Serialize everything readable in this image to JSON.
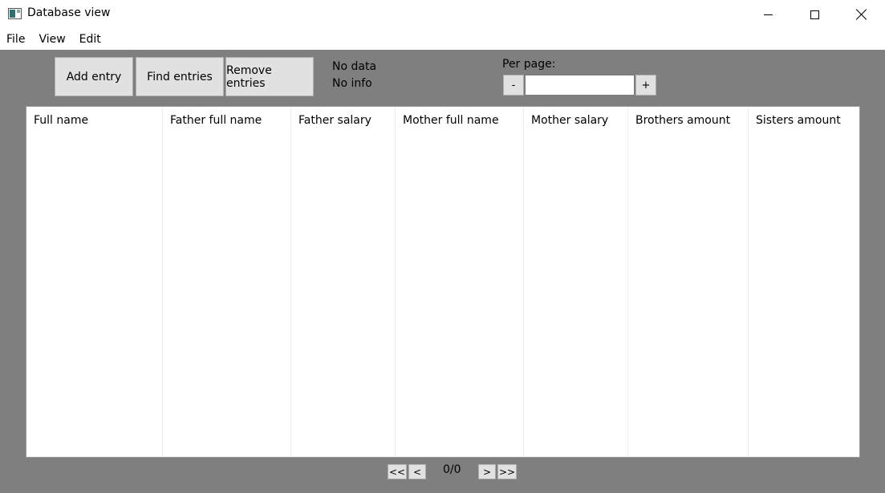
{
  "window": {
    "title": "Database view"
  },
  "menu": {
    "items": [
      {
        "label": "File"
      },
      {
        "label": "View"
      },
      {
        "label": "Edit"
      }
    ]
  },
  "toolbar": {
    "add_label": "Add entry",
    "find_label": "Find entries",
    "remove_label": "Remove entries"
  },
  "status": {
    "data_text": "No data",
    "info_text": "No info"
  },
  "per_page": {
    "label": "Per page:",
    "minus_label": "-",
    "plus_label": "+",
    "value": ""
  },
  "table": {
    "columns": [
      {
        "label": "Full name"
      },
      {
        "label": "Father full name"
      },
      {
        "label": "Father salary"
      },
      {
        "label": "Mother full name"
      },
      {
        "label": "Mother salary"
      },
      {
        "label": "Brothers amount"
      },
      {
        "label": "Sisters amount"
      }
    ],
    "rows": []
  },
  "pager": {
    "first_label": "<<",
    "prev_label": "<",
    "next_label": ">",
    "last_label": ">>",
    "page_text": "0/0"
  }
}
